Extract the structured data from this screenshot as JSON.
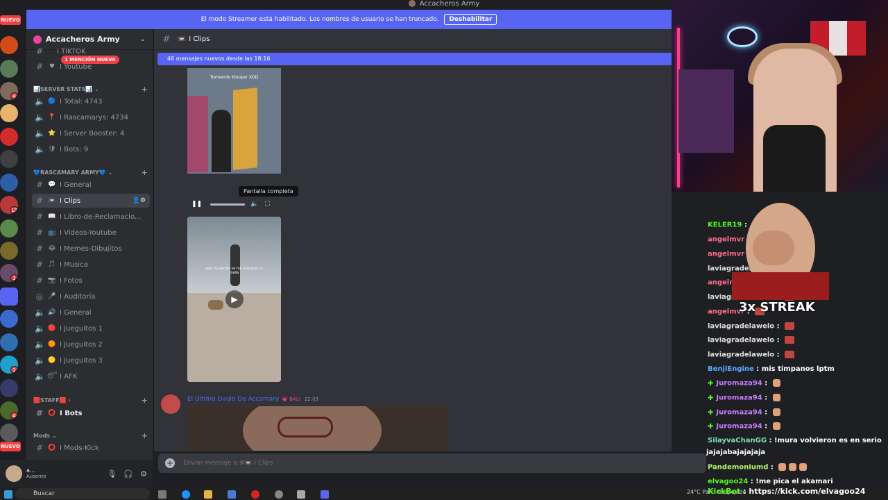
{
  "window": {
    "title": "Accacheros Army"
  },
  "banner": {
    "text": "El modo Streamer está habilitado. Los nombres de usuario se han truncado.",
    "button": "Deshabilitar"
  },
  "guilds": {
    "new_top": "NUEVO",
    "new_bottom": "NUEVO",
    "badges": [
      "4",
      "13",
      "1",
      "1",
      "4",
      "4"
    ]
  },
  "server": {
    "name": "Accacheros Army"
  },
  "mention": "1 MENCIÓN NUEVA",
  "sidebar": {
    "partial_top": "I TIKTOK",
    "youtube": "I Youtube",
    "cat_stats": "📊SERVER STATS📊",
    "stats": [
      {
        "emoji": "🔵",
        "label": "I Total: 4743"
      },
      {
        "emoji": "📍",
        "label": "I Rascamarys: 4734"
      },
      {
        "emoji": "⭐",
        "label": "I Server Booster: 4"
      },
      {
        "emoji": "🛡",
        "label": "I Bots: 9"
      }
    ],
    "cat_army": "💙RASCAMARY ARMY💙",
    "channels": [
      {
        "emoji": "💬",
        "label": "I General"
      },
      {
        "emoji": "📼",
        "label": "I Clips"
      },
      {
        "emoji": "📖",
        "label": "I Libro-de-Reclamacio..."
      },
      {
        "emoji": "📺",
        "label": "I Videos-Youtube"
      },
      {
        "emoji": "😂",
        "label": "I Memes-Dibujitos"
      },
      {
        "emoji": "🎵",
        "label": "I Musica"
      },
      {
        "emoji": "📷",
        "label": "I Fotos"
      },
      {
        "emoji": "🎤",
        "label": "I Auditoria"
      },
      {
        "emoji": "🔊",
        "label": "I General"
      },
      {
        "emoji": "🔴",
        "label": "I Jueguitos 1"
      },
      {
        "emoji": "🟠",
        "label": "I Jueguitos 2"
      },
      {
        "emoji": "🟡",
        "label": "I Jueguitos 3"
      },
      {
        "emoji": "😴",
        "label": "I AFK"
      }
    ],
    "cat_staff": "🟥STAFF🟥",
    "bots": "I Bots",
    "cat_mods": "Mods",
    "mods_kick": "I Mods-Kick"
  },
  "user": {
    "name": "a...",
    "status": "Ausente"
  },
  "channel_header": {
    "name": "I Clips",
    "icon": "📼"
  },
  "new_messages": "46 mensajes nuevos desde las 18:16",
  "video1": {
    "caption": "Tremendo blooper XDD"
  },
  "tooltip": "Pantalla completa",
  "video2": {
    "caption": "pov: tu perrito se fue a buscar tu toalla"
  },
  "message": {
    "author": "El Ultimo Ovulo De Accamary",
    "tag": "💗 BALI",
    "time": "22:03"
  },
  "composer": {
    "placeholder": "Enviar mensaje a #📼 I Clips"
  },
  "kick_chat": [
    {
      "user": "KELER19",
      "color": "#53fc18",
      "msg": "",
      "kind": "emote"
    },
    {
      "user": "angelmvr",
      "color": "#ff6b8b",
      "msg": "",
      "kind": "emote"
    },
    {
      "user": "angelmvr",
      "color": "#ff6b8b",
      "msg": "",
      "kind": "emote"
    },
    {
      "user": "laviagradelawelo",
      "color": "#e0e0e0",
      "msg": "",
      "kind": "emote"
    },
    {
      "user": "angelmvr",
      "color": "#ff6b8b",
      "msg": "",
      "kind": "emote"
    },
    {
      "user": "laviagradelawelo",
      "color": "#e0e0e0",
      "msg": "",
      "kind": "emote"
    },
    {
      "user": "angelmvr",
      "color": "#ff6b8b",
      "msg": "",
      "kind": "emote"
    },
    {
      "user": "laviagradelawelo",
      "color": "#e0e0e0",
      "msg": "",
      "kind": "emote"
    },
    {
      "user": "laviagradelawelo",
      "color": "#e0e0e0",
      "msg": "",
      "kind": "emote"
    },
    {
      "user": "laviagradelawelo",
      "color": "#e0e0e0",
      "msg": "",
      "kind": "emote"
    },
    {
      "user": "BenjiEngine",
      "color": "#5aa9ff",
      "msg": "mis timpanos lptm",
      "kind": "text"
    },
    {
      "user": "Juromaza94",
      "color": "#c77dff",
      "msg": "",
      "kind": "hand"
    },
    {
      "user": "Juromaza94",
      "color": "#c77dff",
      "msg": "",
      "kind": "hand"
    },
    {
      "user": "Juromaza94",
      "color": "#c77dff",
      "msg": "",
      "kind": "hand"
    },
    {
      "user": "Juromaza94",
      "color": "#c77dff",
      "msg": "",
      "kind": "hand"
    },
    {
      "user": "SilayvaChanGG",
      "color": "#7ee0b5",
      "msg": "!mura volvieron es en serio",
      "kind": "text"
    },
    {
      "user": "",
      "color": "#ffffff",
      "msg": "jajajabajajajaja",
      "kind": "cont"
    },
    {
      "user": "Pandemoniumd",
      "color": "#b5f46a",
      "msg": "",
      "kind": "hands"
    },
    {
      "user": "elvagoo24",
      "color": "#53fc18",
      "msg": "!me pica el akamari",
      "kind": "text"
    }
  ],
  "streak": "3x STREAK",
  "kickbot": {
    "user": "KickBot",
    "msg": "https://kick.com/elvagoo24"
  },
  "taskbar": {
    "search": "Buscar",
    "weather": "24°C Parc. despejado"
  }
}
